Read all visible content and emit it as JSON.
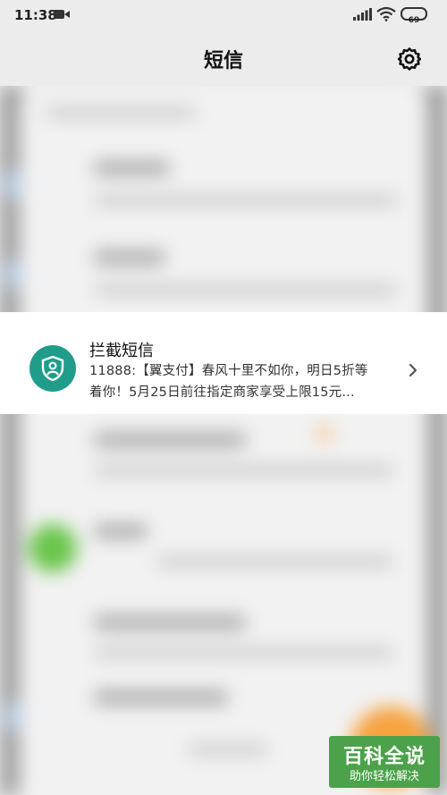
{
  "status_bar": {
    "time": "11:38",
    "battery": "69",
    "icons": [
      "video-camera-icon",
      "signal-icon",
      "wifi-icon",
      "battery-icon"
    ]
  },
  "header": {
    "title": "短信",
    "settings_icon": "gear-icon"
  },
  "blocked_sms": {
    "title": "拦截短信",
    "preview_line1": "11888:【翼支付】春风十里不如你，明日5折等",
    "preview_line2": "着你！5月25日前往指定商家享受上限15元...",
    "icon": "shield-user-icon",
    "chevron_icon": "chevron-right-icon"
  },
  "watermark": {
    "main": "百科全说",
    "sub": "助你轻松解决"
  },
  "colors": {
    "accent_teal": "#1f9d8a",
    "watermark_green": "#4ca24a"
  }
}
